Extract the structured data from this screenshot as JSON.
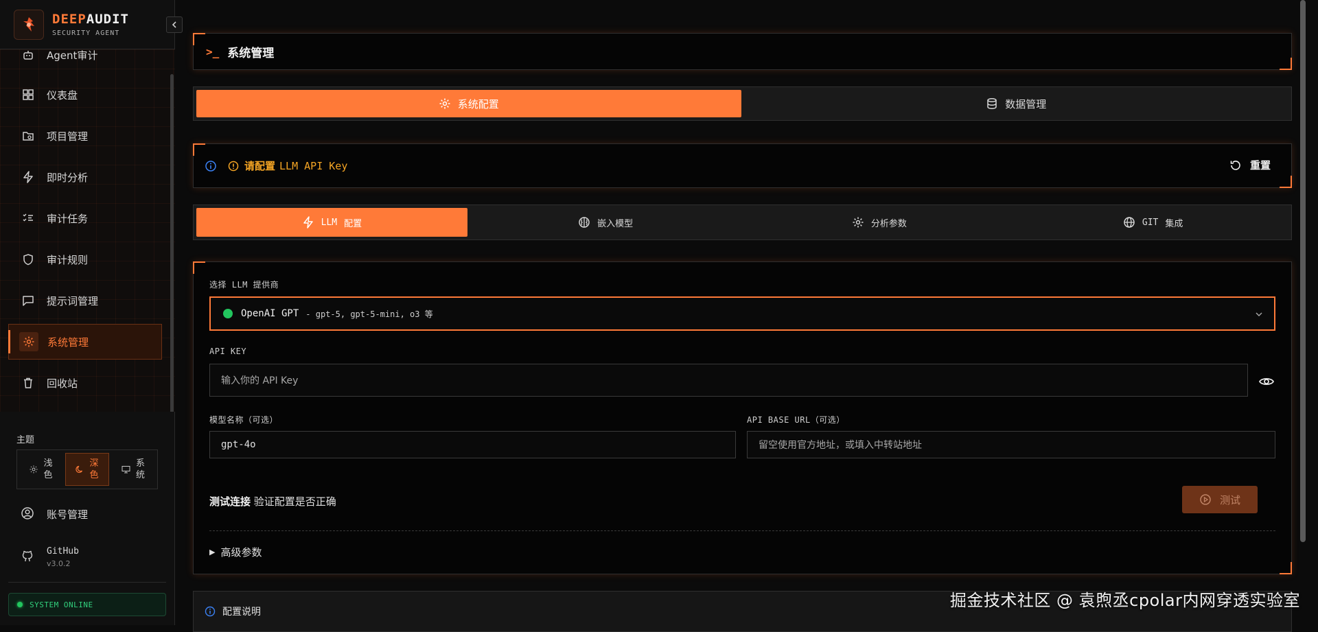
{
  "brand": {
    "title_a": "DEEP",
    "title_b": "AUDIT",
    "subtitle": "SECURITY AGENT"
  },
  "sidebar": {
    "items": [
      {
        "label": "Agent审计",
        "icon": "bot-icon",
        "active": false
      },
      {
        "label": "仪表盘",
        "icon": "dashboard-icon",
        "active": false
      },
      {
        "label": "项目管理",
        "icon": "folder-search-icon",
        "active": false
      },
      {
        "label": "即时分析",
        "icon": "zap-icon",
        "active": false
      },
      {
        "label": "审计任务",
        "icon": "list-check-icon",
        "active": false
      },
      {
        "label": "审计规则",
        "icon": "shield-icon",
        "active": false
      },
      {
        "label": "提示词管理",
        "icon": "message-icon",
        "active": false
      },
      {
        "label": "系统管理",
        "icon": "gear-icon",
        "active": true
      },
      {
        "label": "回收站",
        "icon": "trash-icon",
        "active": false
      }
    ],
    "theme_label": "主题",
    "themes": [
      {
        "label": "浅色",
        "icon": "sun-icon",
        "active": false
      },
      {
        "label": "深色",
        "icon": "moon-icon",
        "active": true
      },
      {
        "label": "系统",
        "icon": "monitor-icon",
        "active": false
      }
    ],
    "account": "账号管理",
    "github": {
      "label": "GitHub",
      "version": "v3.0.2"
    },
    "status": "SYSTEM ONLINE"
  },
  "page": {
    "prompt": ">_",
    "title": "系统管理",
    "tabs": [
      {
        "label": "系统配置",
        "icon": "gear-icon",
        "active": true
      },
      {
        "label": "数据管理",
        "icon": "database-icon",
        "active": false
      }
    ],
    "notice": {
      "warn_bold": "请配置",
      "warn_rest": "LLM API Key",
      "reset": "重置"
    },
    "config_tabs": [
      {
        "prefix": "LLM",
        "label": "配置",
        "icon": "zap-icon",
        "active": true
      },
      {
        "prefix": "",
        "label": "嵌入模型",
        "icon": "brain-icon",
        "active": false
      },
      {
        "prefix": "",
        "label": "分析参数",
        "icon": "gear-icon",
        "active": false
      },
      {
        "prefix": "GIT",
        "label": "集成",
        "icon": "globe-icon",
        "active": false
      }
    ],
    "form": {
      "provider_label": "选择 LLM 提供商",
      "provider_name": "OpenAI GPT",
      "provider_desc": "- gpt-5, gpt-5-mini, o3 等",
      "api_key_label": "API KEY",
      "api_key_placeholder": "输入你的 API Key",
      "model_label": "模型名称（可选）",
      "model_value": "gpt-4o",
      "base_url_label": "API BASE URL（可选）",
      "base_url_placeholder": "留空使用官方地址，或填入中转站地址",
      "test_title": "测试连接",
      "test_desc": "验证配置是否正确",
      "test_button": "测试",
      "advanced": "高级参数"
    },
    "help": "配置说明"
  },
  "watermark": "掘金技术社区 @ 袁煦丞cpolar内网穿透实验室",
  "colors": {
    "accent": "#ff7a38",
    "online": "#22c55e",
    "warn": "#f5a524",
    "info": "#3b82f6"
  }
}
